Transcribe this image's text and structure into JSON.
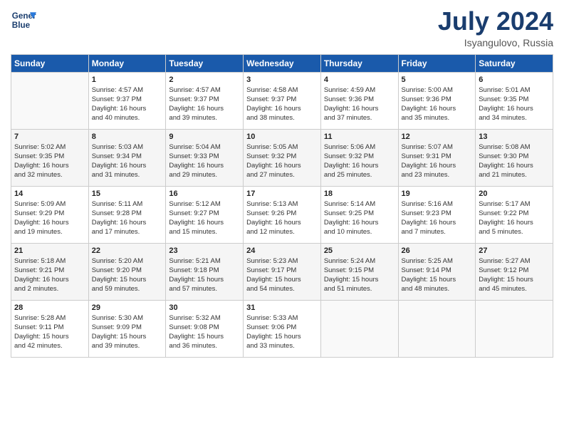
{
  "header": {
    "logo_line1": "General",
    "logo_line2": "Blue",
    "month_title": "July 2024",
    "location": "Isyangulovo, Russia"
  },
  "weekdays": [
    "Sunday",
    "Monday",
    "Tuesday",
    "Wednesday",
    "Thursday",
    "Friday",
    "Saturday"
  ],
  "weeks": [
    [
      {
        "day": "",
        "info": ""
      },
      {
        "day": "1",
        "info": "Sunrise: 4:57 AM\nSunset: 9:37 PM\nDaylight: 16 hours\nand 40 minutes."
      },
      {
        "day": "2",
        "info": "Sunrise: 4:57 AM\nSunset: 9:37 PM\nDaylight: 16 hours\nand 39 minutes."
      },
      {
        "day": "3",
        "info": "Sunrise: 4:58 AM\nSunset: 9:37 PM\nDaylight: 16 hours\nand 38 minutes."
      },
      {
        "day": "4",
        "info": "Sunrise: 4:59 AM\nSunset: 9:36 PM\nDaylight: 16 hours\nand 37 minutes."
      },
      {
        "day": "5",
        "info": "Sunrise: 5:00 AM\nSunset: 9:36 PM\nDaylight: 16 hours\nand 35 minutes."
      },
      {
        "day": "6",
        "info": "Sunrise: 5:01 AM\nSunset: 9:35 PM\nDaylight: 16 hours\nand 34 minutes."
      }
    ],
    [
      {
        "day": "7",
        "info": "Sunrise: 5:02 AM\nSunset: 9:35 PM\nDaylight: 16 hours\nand 32 minutes."
      },
      {
        "day": "8",
        "info": "Sunrise: 5:03 AM\nSunset: 9:34 PM\nDaylight: 16 hours\nand 31 minutes."
      },
      {
        "day": "9",
        "info": "Sunrise: 5:04 AM\nSunset: 9:33 PM\nDaylight: 16 hours\nand 29 minutes."
      },
      {
        "day": "10",
        "info": "Sunrise: 5:05 AM\nSunset: 9:32 PM\nDaylight: 16 hours\nand 27 minutes."
      },
      {
        "day": "11",
        "info": "Sunrise: 5:06 AM\nSunset: 9:32 PM\nDaylight: 16 hours\nand 25 minutes."
      },
      {
        "day": "12",
        "info": "Sunrise: 5:07 AM\nSunset: 9:31 PM\nDaylight: 16 hours\nand 23 minutes."
      },
      {
        "day": "13",
        "info": "Sunrise: 5:08 AM\nSunset: 9:30 PM\nDaylight: 16 hours\nand 21 minutes."
      }
    ],
    [
      {
        "day": "14",
        "info": "Sunrise: 5:09 AM\nSunset: 9:29 PM\nDaylight: 16 hours\nand 19 minutes."
      },
      {
        "day": "15",
        "info": "Sunrise: 5:11 AM\nSunset: 9:28 PM\nDaylight: 16 hours\nand 17 minutes."
      },
      {
        "day": "16",
        "info": "Sunrise: 5:12 AM\nSunset: 9:27 PM\nDaylight: 16 hours\nand 15 minutes."
      },
      {
        "day": "17",
        "info": "Sunrise: 5:13 AM\nSunset: 9:26 PM\nDaylight: 16 hours\nand 12 minutes."
      },
      {
        "day": "18",
        "info": "Sunrise: 5:14 AM\nSunset: 9:25 PM\nDaylight: 16 hours\nand 10 minutes."
      },
      {
        "day": "19",
        "info": "Sunrise: 5:16 AM\nSunset: 9:23 PM\nDaylight: 16 hours\nand 7 minutes."
      },
      {
        "day": "20",
        "info": "Sunrise: 5:17 AM\nSunset: 9:22 PM\nDaylight: 16 hours\nand 5 minutes."
      }
    ],
    [
      {
        "day": "21",
        "info": "Sunrise: 5:18 AM\nSunset: 9:21 PM\nDaylight: 16 hours\nand 2 minutes."
      },
      {
        "day": "22",
        "info": "Sunrise: 5:20 AM\nSunset: 9:20 PM\nDaylight: 15 hours\nand 59 minutes."
      },
      {
        "day": "23",
        "info": "Sunrise: 5:21 AM\nSunset: 9:18 PM\nDaylight: 15 hours\nand 57 minutes."
      },
      {
        "day": "24",
        "info": "Sunrise: 5:23 AM\nSunset: 9:17 PM\nDaylight: 15 hours\nand 54 minutes."
      },
      {
        "day": "25",
        "info": "Sunrise: 5:24 AM\nSunset: 9:15 PM\nDaylight: 15 hours\nand 51 minutes."
      },
      {
        "day": "26",
        "info": "Sunrise: 5:25 AM\nSunset: 9:14 PM\nDaylight: 15 hours\nand 48 minutes."
      },
      {
        "day": "27",
        "info": "Sunrise: 5:27 AM\nSunset: 9:12 PM\nDaylight: 15 hours\nand 45 minutes."
      }
    ],
    [
      {
        "day": "28",
        "info": "Sunrise: 5:28 AM\nSunset: 9:11 PM\nDaylight: 15 hours\nand 42 minutes."
      },
      {
        "day": "29",
        "info": "Sunrise: 5:30 AM\nSunset: 9:09 PM\nDaylight: 15 hours\nand 39 minutes."
      },
      {
        "day": "30",
        "info": "Sunrise: 5:32 AM\nSunset: 9:08 PM\nDaylight: 15 hours\nand 36 minutes."
      },
      {
        "day": "31",
        "info": "Sunrise: 5:33 AM\nSunset: 9:06 PM\nDaylight: 15 hours\nand 33 minutes."
      },
      {
        "day": "",
        "info": ""
      },
      {
        "day": "",
        "info": ""
      },
      {
        "day": "",
        "info": ""
      }
    ]
  ]
}
